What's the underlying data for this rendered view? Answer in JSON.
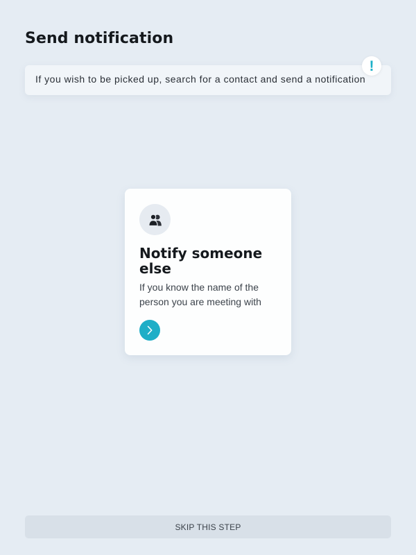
{
  "page": {
    "title": "Send notification"
  },
  "info_banner": {
    "text": "If you wish to be picked up, search for a contact and send a notification",
    "badge_icon": "exclamation-icon",
    "badge_symbol": "!",
    "accent_color": "#1cb0c8"
  },
  "option_card": {
    "icon": "users-icon",
    "title": "Notify someone else",
    "description": "If you know the name of the person you are meeting with",
    "action_icon": "chevron-right-icon",
    "action_color": "#1eaec7"
  },
  "footer": {
    "skip_label": "SKIP THIS STEP"
  }
}
